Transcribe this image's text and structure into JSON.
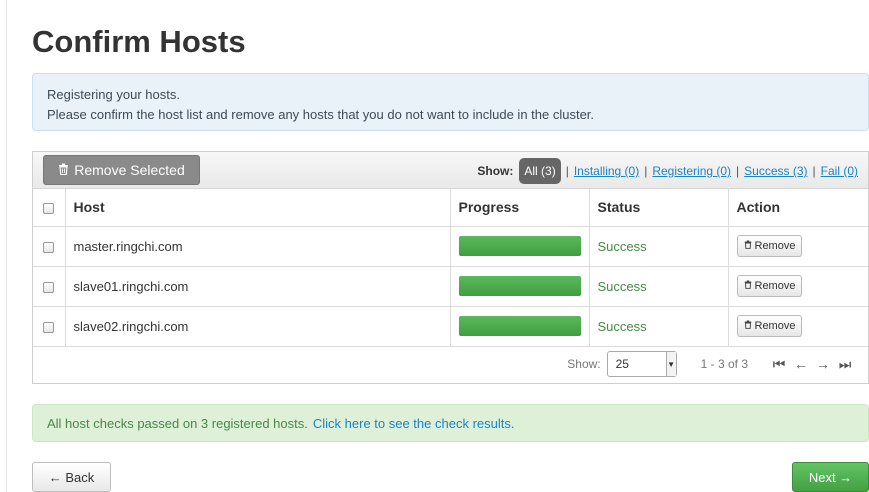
{
  "page": {
    "title": "Confirm Hosts"
  },
  "info": {
    "line1": "Registering your hosts.",
    "line2": "Please confirm the host list and remove any hosts that you do not want to include in the cluster."
  },
  "toolbar": {
    "remove_selected_label": "Remove Selected",
    "trash_icon": "trash-icon",
    "show_label": "Show:",
    "filters": {
      "all": "All (3)",
      "installing": "Installing (0)",
      "registering": "Registering (0)",
      "success": "Success (3)",
      "fail": "Fail (0)"
    }
  },
  "table": {
    "headers": {
      "host": "Host",
      "progress": "Progress",
      "status": "Status",
      "action": "Action"
    },
    "rows": [
      {
        "host": "master.ringchi.com",
        "progress": 1.0,
        "status": "Success",
        "action": "Remove"
      },
      {
        "host": "slave01.ringchi.com",
        "progress": 1.0,
        "status": "Success",
        "action": "Remove"
      },
      {
        "host": "slave02.ringchi.com",
        "progress": 1.0,
        "status": "Success",
        "action": "Remove"
      }
    ]
  },
  "pager": {
    "show_label": "Show:",
    "page_size": "25",
    "range": "1 - 3 of 3"
  },
  "checks": {
    "message": "All host checks passed on 3 registered hosts.",
    "link": "Click here to see the check results."
  },
  "nav": {
    "back_label": "← Back",
    "next_label": "Next →"
  },
  "colors": {
    "progress": "#5cb85c",
    "success_text": "#468847",
    "link": "#1a84c7",
    "next_button": "#5bb75b"
  }
}
